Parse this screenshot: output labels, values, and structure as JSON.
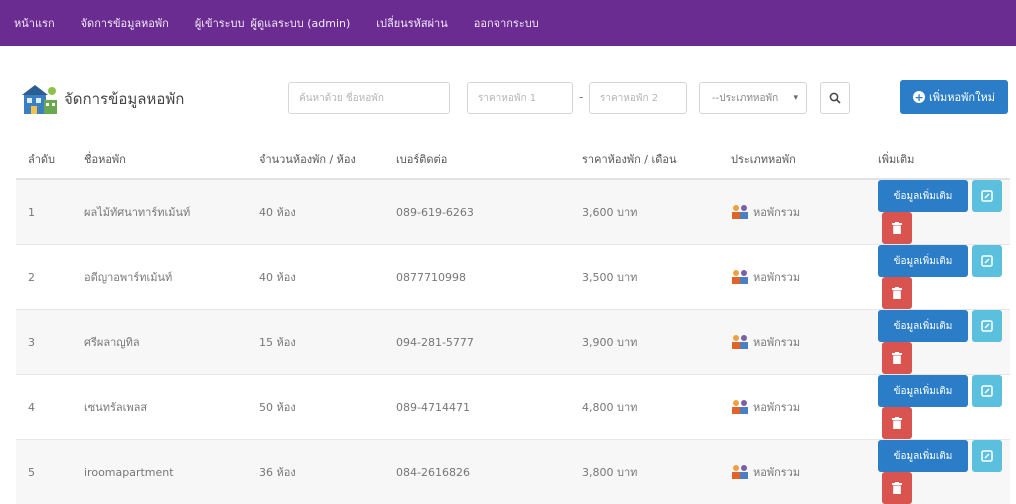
{
  "nav": {
    "home": "หน้าแรก",
    "manage": "จัดการข้อมูลหอพัก",
    "user_label": "ผู้เข้าระบบ",
    "user_name": "ผู้ดูแลระบบ (admin)",
    "change_password": "เปลี่ยนรหัสผ่าน",
    "logout": "ออกจากระบบ"
  },
  "page": {
    "title": "จัดการข้อมูลหอพัก"
  },
  "search": {
    "name_placeholder": "ค้นหาด้วย ชื่อหอพัก",
    "price1_placeholder": "ราคาหอพัก 1",
    "dash": "-",
    "price2_placeholder": "ราคาหอพัก 2",
    "type_selected": "--ประเภทหอพัก"
  },
  "add_button": "เพิ่มหอพักใหม่",
  "table": {
    "headers": [
      "ลำดับ",
      "ชื่อหอพัก",
      "จำนวนห้องพัก / ห้อง",
      "เบอร์ติดต่อ",
      "ราคาห้องพัก / เดือน",
      "ประเภทหอพัก",
      "เพิ่มเติม"
    ],
    "rows": [
      {
        "no": "1",
        "name": "ผลไม้ทัศนาทาร์ทเม้นท์",
        "rooms": "40 ห้อง",
        "phone": "089-619-6263",
        "price": "3,600 บาท",
        "type": "หอพักรวม",
        "detail": "ข้อมูลเพิ่มเติม"
      },
      {
        "no": "2",
        "name": "อดีญาอพาร์ทเม้นท์",
        "rooms": "40 ห้อง",
        "phone": "0877710998",
        "price": "3,500 บาท",
        "type": "หอพักรวม",
        "detail": "ข้อมูลเพิ่มเติม"
      },
      {
        "no": "3",
        "name": "ศรีผลาญทิล",
        "rooms": "15 ห้อง",
        "phone": "094-281-5777",
        "price": "3,900 บาท",
        "type": "หอพักรวม",
        "detail": "ข้อมูลเพิ่มเติม"
      },
      {
        "no": "4",
        "name": "เซนทรัลเพลส",
        "rooms": "50 ห้อง",
        "phone": "089-4714471",
        "price": "4,800 บาท",
        "type": "หอพักรวม",
        "detail": "ข้อมูลเพิ่มเติม"
      },
      {
        "no": "5",
        "name": "iroomapartment",
        "rooms": "36 ห้อง",
        "phone": "084-2616826",
        "price": "3,800 บาท",
        "type": "หอพักรวม",
        "detail": "ข้อมูลเพิ่มเติม"
      }
    ]
  },
  "colors": {
    "nav_bg": "#6a2c91",
    "primary": "#2a7dc6",
    "info": "#5bc0de",
    "danger": "#d9534f"
  }
}
